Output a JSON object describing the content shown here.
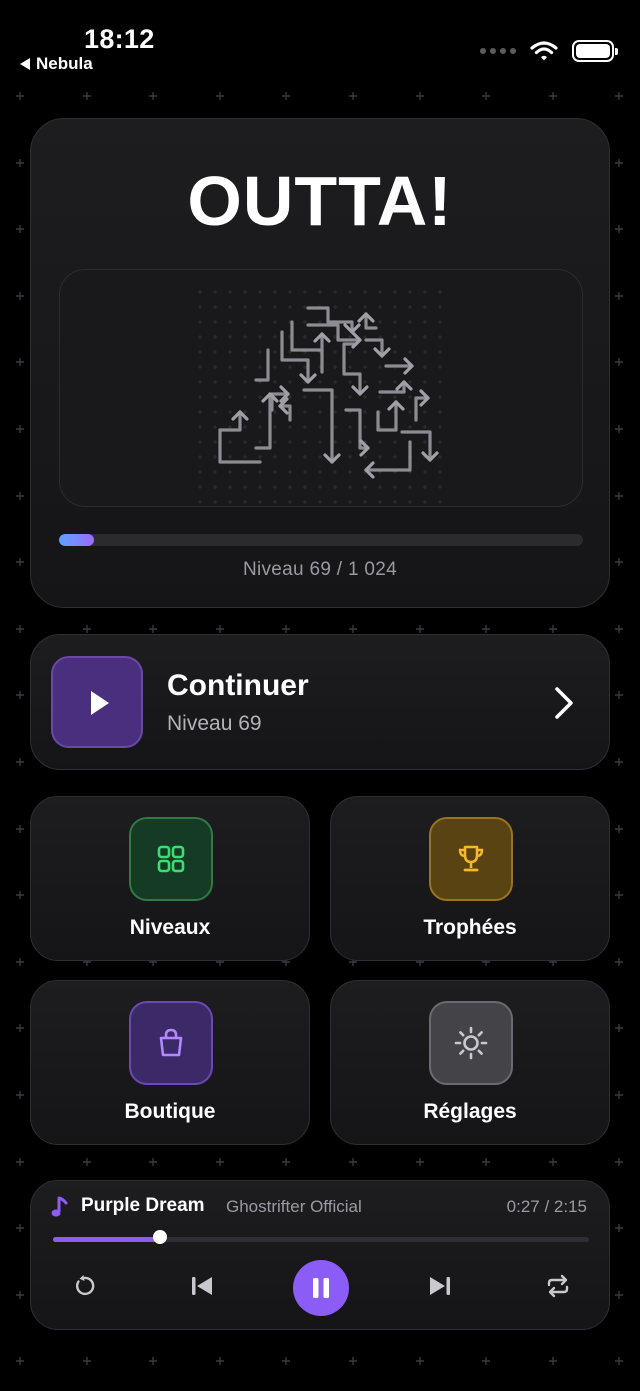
{
  "status": {
    "time": "18:12",
    "back_label": "Nebula"
  },
  "hero": {
    "title": "OUTTA!",
    "level_caption": "Niveau 69 / 1 024",
    "progress": 0.067
  },
  "continue_card": {
    "title": "Continuer",
    "subtitle": "Niveau 69"
  },
  "menu": {
    "levels": "Niveaux",
    "trophies": "Trophées",
    "shop": "Boutique",
    "settings": "Réglages"
  },
  "player": {
    "track": "Purple Dream",
    "artist": "Ghostrifter Official",
    "time": "0:27 / 2:15",
    "progress": 0.2
  },
  "colors": {
    "accent": "#8b5cf6",
    "background": "#000000",
    "card": "#1a1a1d",
    "levels_icon": "#3ddc74",
    "trophy_icon": "#f5b82a",
    "shop_icon": "#b388ff",
    "settings_icon": "#c8c8cf"
  },
  "icons": {
    "levels": "grid-icon",
    "trophies": "trophy-icon",
    "shop": "shopping-bag-icon",
    "settings": "sun-gear-icon",
    "player": [
      "music-note-icon",
      "replay-icon",
      "previous-icon",
      "pause-icon",
      "next-icon",
      "repeat-icon"
    ]
  }
}
